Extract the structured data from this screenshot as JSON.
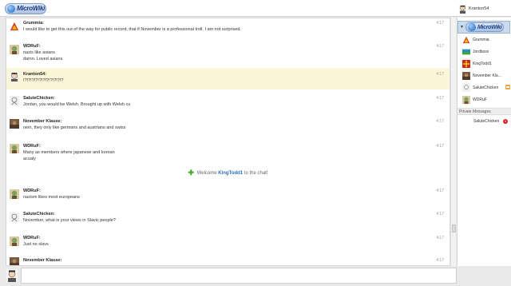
{
  "header": {
    "logo_text": "MicroWiki",
    "current_user": "Kranton54"
  },
  "messages": [
    {
      "name": "Grummia:",
      "lines": [
        "I would like to get this out of the way for public record, that if November is a professional troll, I am not surprised."
      ],
      "time": "4:17",
      "avatar": "red-triangle",
      "highlight": false
    },
    {
      "name": "WDRuF:",
      "lines": [
        "nazis like asians",
        "damn. Loved asians"
      ],
      "time": "4:17",
      "avatar": "cartoon",
      "highlight": false
    },
    {
      "name": "Kranton54:",
      "lines": [
        "!?!?!?!?!?!?!?!?!?!?!?"
      ],
      "time": "4:17",
      "avatar": "face",
      "highlight": true
    },
    {
      "name": "SaluteChicken:",
      "lines": [
        "Jordan, you would be Welsh. Brought up with Welsh cu"
      ],
      "time": "4:17",
      "avatar": "sketch",
      "highlight": false
    },
    {
      "name": "November Klause:",
      "lines": [
        "nein, they only like germans and austrians and swiss"
      ],
      "time": "4:17",
      "avatar": "photo",
      "highlight": false
    },
    {
      "name": "WDRuF:",
      "lines": [
        "Many as members where japanese and korean",
        "acualy"
      ],
      "time": "4:17",
      "avatar": "cartoon",
      "highlight": false
    },
    {
      "name": "WDRuF:",
      "lines": [
        "nazism likes most europeans"
      ],
      "time": "4:17",
      "avatar": "cartoon",
      "highlight": false
    },
    {
      "name": "SaluteChicken:",
      "lines": [
        "November, what is your views in Slavic people?"
      ],
      "time": "4:17",
      "avatar": "sketch",
      "highlight": false
    },
    {
      "name": "WDRuF:",
      "lines": [
        "Just no slavs"
      ],
      "time": "4:17",
      "avatar": "cartoon",
      "highlight": false
    },
    {
      "name": "November Klause:",
      "lines": [
        ""
      ],
      "time": "4:17",
      "avatar": "photo",
      "highlight": false
    }
  ],
  "welcome": {
    "prefix": "Welcome",
    "user": "KingTodd1",
    "suffix": "to the chat!"
  },
  "sidebar": {
    "wiki_label": "MicroWiki",
    "users": [
      {
        "name": "Grummia",
        "avatar": "red-triangle",
        "away": false
      },
      {
        "name": "Jordboss",
        "avatar": "flag",
        "away": false
      },
      {
        "name": "KingTodd1",
        "avatar": "red-cross",
        "away": false
      },
      {
        "name": "November Kla...",
        "avatar": "photo",
        "away": false
      },
      {
        "name": "SaluteChicken",
        "avatar": "sketch",
        "away": true
      },
      {
        "name": "WDRuF",
        "avatar": "cartoon",
        "away": false
      }
    ],
    "private_header": "Private Messages",
    "private": [
      {
        "name": "SaluteChicken",
        "count": "1"
      }
    ]
  },
  "input": {
    "value": ""
  }
}
